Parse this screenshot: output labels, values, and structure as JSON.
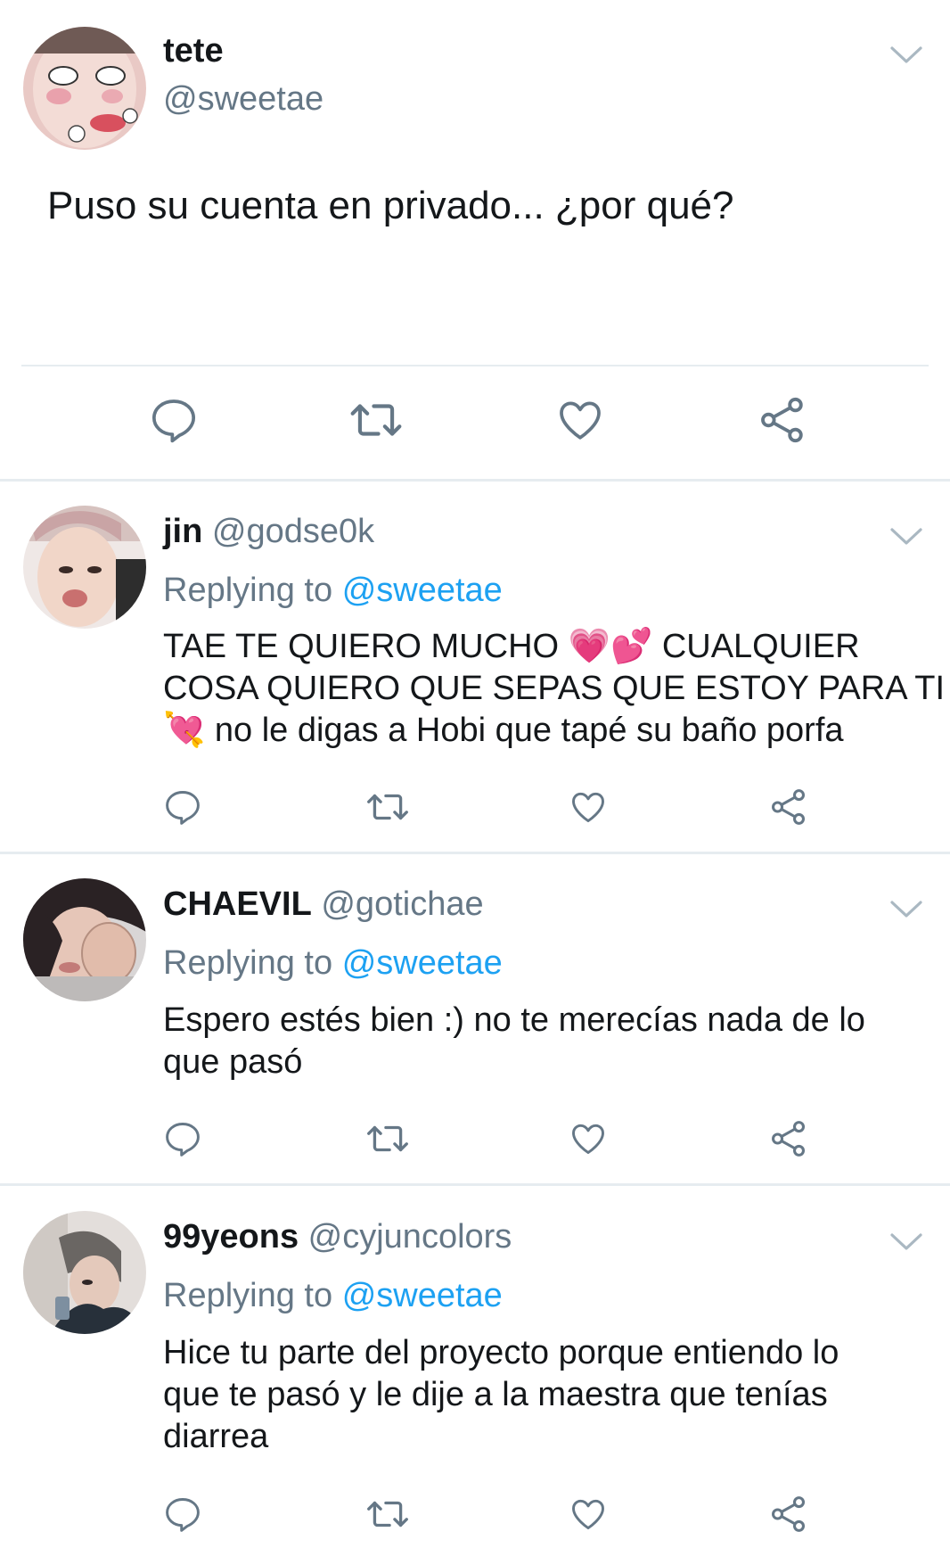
{
  "colors": {
    "text": "#14171a",
    "muted": "#657786",
    "link": "#1da1f2",
    "icon": "#657786",
    "divider": "#e6ecf0"
  },
  "main_tweet": {
    "display_name": "tete",
    "handle": "@sweetae",
    "text": "Puso su cuenta en privado... ¿por qué?",
    "actions": [
      "reply-icon",
      "retweet-icon",
      "like-icon",
      "share-icon"
    ]
  },
  "replies": [
    {
      "display_name": "jin",
      "handle": "@godse0k",
      "replying_label": "Replying to",
      "replying_to": "@sweetae",
      "text_line_1": "TAE TE QUIERO MUCHO 💗💕 CUALQUIER",
      "text_line_2": "COSA QUIERO QUE SEPAS QUE ESTOY PARA TI",
      "text_line_3": "💘 no le digas a Hobi que tapé su baño porfa"
    },
    {
      "display_name": "CHAEVIL",
      "handle": "@gotichae",
      "replying_label": "Replying to",
      "replying_to": "@sweetae",
      "text_line_1": "Espero estés bien :) no te merecías nada de lo",
      "text_line_2": "que pasó"
    },
    {
      "display_name": "99yeons",
      "handle": "@cyjuncolors",
      "replying_label": "Replying to",
      "replying_to": "@sweetae",
      "text_line_1": "Hice tu parte del proyecto porque entiendo lo",
      "text_line_2": "que te pasó y le dije a la maestra que tenías",
      "text_line_3": "diarrea"
    }
  ]
}
